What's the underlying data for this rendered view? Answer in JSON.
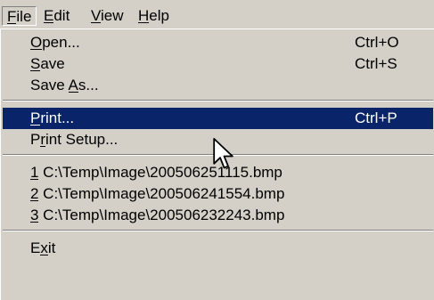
{
  "menubar": {
    "items": [
      {
        "label": "File",
        "mn": "F"
      },
      {
        "label": "Edit",
        "mn": "E"
      },
      {
        "label": "View",
        "mn": "V"
      },
      {
        "label": "Help",
        "mn": "H"
      }
    ]
  },
  "file_menu": {
    "items": [
      {
        "label": "Open...",
        "mn": "O",
        "shortcut": "Ctrl+O"
      },
      {
        "label": "Save",
        "mn": "S",
        "shortcut": "Ctrl+S"
      },
      {
        "label": "Save As...",
        "mn": "A",
        "shortcut": ""
      },
      {
        "label": "Print...",
        "mn": "P",
        "shortcut": "Ctrl+P"
      },
      {
        "label": "Print Setup...",
        "mn": "r",
        "shortcut": ""
      },
      {
        "label": "1 C:\\Temp\\Image\\200506251115.bmp",
        "mn": "1",
        "shortcut": ""
      },
      {
        "label": "2 C:\\Temp\\Image\\200506241554.bmp",
        "mn": "2",
        "shortcut": ""
      },
      {
        "label": "3 C:\\Temp\\Image\\200506232243.bmp",
        "mn": "3",
        "shortcut": ""
      },
      {
        "label": "Exit",
        "mn": "x",
        "shortcut": ""
      }
    ]
  },
  "colors": {
    "menu_bg": "#d4d0c8",
    "highlight_bg": "#0a246a",
    "highlight_text": "#ffffff"
  },
  "icons": [
    "mouse-pointer-icon"
  ]
}
